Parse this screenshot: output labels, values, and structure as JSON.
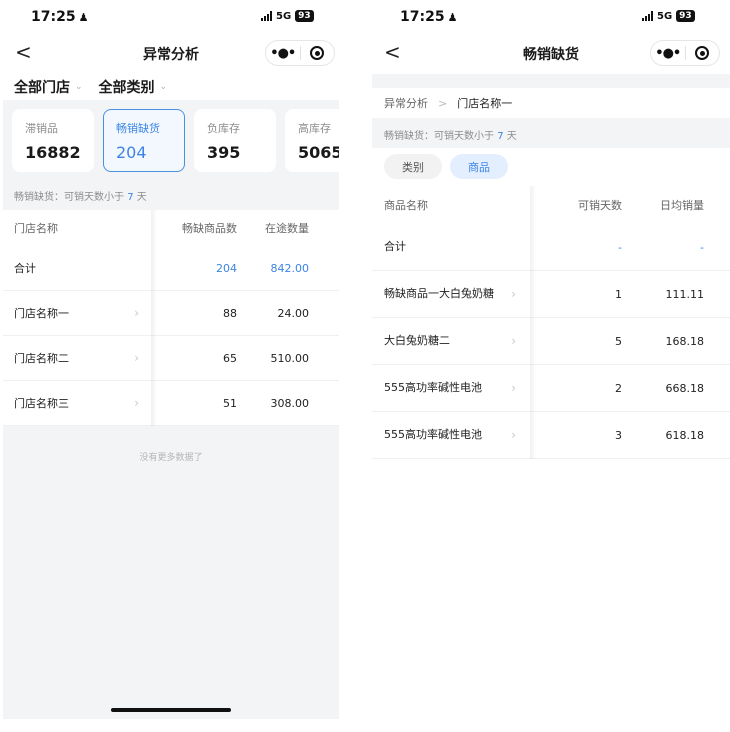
{
  "left": {
    "status": {
      "time": "17:25",
      "network": "5G",
      "battery": "93"
    },
    "nav": {
      "back_glyph": "<",
      "title": "异常分析",
      "more_glyph": "•●•"
    },
    "filters": [
      {
        "label": "全部门店"
      },
      {
        "label": "全部类别"
      }
    ],
    "cards": [
      {
        "label": "滞销品",
        "value": "16882",
        "active": false
      },
      {
        "label": "畅销缺货",
        "value": "204",
        "active": true
      },
      {
        "label": "负库存",
        "value": "395",
        "active": false
      },
      {
        "label": "高库存",
        "value": "5065",
        "active": false
      }
    ],
    "hint": {
      "prefix": "畅销缺货：可销天数小于",
      "num": "7",
      "suffix": "天"
    },
    "table": {
      "headers": [
        "门店名称",
        "畅缺商品数",
        "在途数量"
      ],
      "rows": [
        {
          "name": "合计",
          "count": "204",
          "transit": "842.00"
        },
        {
          "name": "门店名称一",
          "count": "88",
          "transit": "24.00"
        },
        {
          "name": "门店名称二",
          "count": "65",
          "transit": "510.00"
        },
        {
          "name": "门店名称三",
          "count": "51",
          "transit": "308.00"
        }
      ]
    },
    "no_more": "没有更多数据了"
  },
  "right": {
    "status": {
      "time": "17:25",
      "network": "5G",
      "battery": "93"
    },
    "nav": {
      "back_glyph": "<",
      "title": "畅销缺货",
      "more_glyph": "•●•"
    },
    "breadcrumb": {
      "prev": "异常分析",
      "sep": ">",
      "current": "门店名称一"
    },
    "hint": {
      "prefix": "畅销缺货：可销天数小于",
      "num": "7",
      "suffix": "天"
    },
    "tabs": [
      {
        "label": "类别",
        "active": false
      },
      {
        "label": "商品",
        "active": true
      }
    ],
    "table": {
      "headers": [
        "商品名称",
        "可销天数",
        "日均销量"
      ],
      "rows": [
        {
          "name": "合计",
          "days": "-",
          "avg": "-"
        },
        {
          "name": "畅缺商品一大白兔奶糖",
          "days": "1",
          "avg": "111.11"
        },
        {
          "name": "大白兔奶糖二",
          "days": "5",
          "avg": "168.18"
        },
        {
          "name": "555高功率碱性电池",
          "days": "2",
          "avg": "668.18"
        },
        {
          "name": "555高功率碱性电池",
          "days": "3",
          "avg": "618.18"
        }
      ]
    }
  }
}
